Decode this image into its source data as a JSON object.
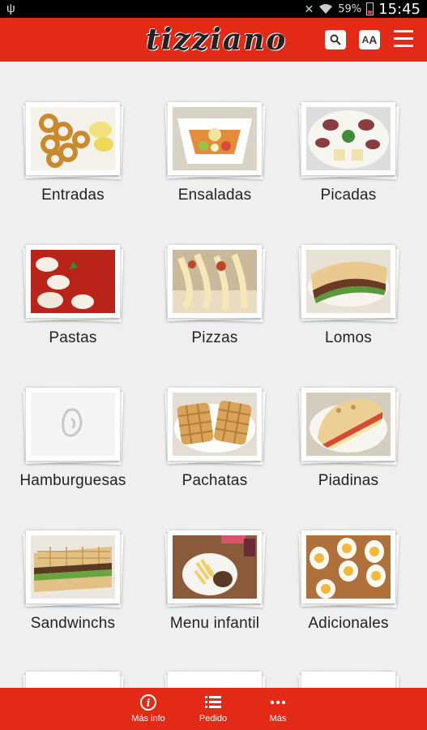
{
  "status_bar": {
    "battery_pct": "59%",
    "time": "15:45",
    "battery_level": 0.3
  },
  "app": {
    "brand": "tizziano",
    "font_button_small": "A",
    "font_button_large": "A",
    "accent": "#e32a17"
  },
  "categories": [
    {
      "label": "Entradas",
      "icon": "fried-calamari-photo"
    },
    {
      "label": "Ensaladas",
      "icon": "salad-photo"
    },
    {
      "label": "Picadas",
      "icon": "cold-cuts-platter-photo"
    },
    {
      "label": "Pastas",
      "icon": "pasta-tomato-sauce-photo"
    },
    {
      "label": "Pizzas",
      "icon": "pizza-cheese-pull-photo"
    },
    {
      "label": "Lomos",
      "icon": "steak-sandwich-photo"
    },
    {
      "label": "Hamburguesas",
      "icon": "placeholder-logo-photo"
    },
    {
      "label": "Pachatas",
      "icon": "waffle-sandwich-photo"
    },
    {
      "label": "Piadinas",
      "icon": "piadina-wrap-photo"
    },
    {
      "label": "Sandwinchs",
      "icon": "sandwich-photo"
    },
    {
      "label": "Menu infantil",
      "icon": "kids-meal-photo"
    },
    {
      "label": "Adicionales",
      "icon": "boiled-eggs-photo"
    }
  ],
  "bottom_nav": [
    {
      "label": "Más info",
      "icon": "info-icon"
    },
    {
      "label": "Pedido",
      "icon": "list-icon"
    },
    {
      "label": "Más",
      "icon": "more-dots-icon"
    }
  ]
}
